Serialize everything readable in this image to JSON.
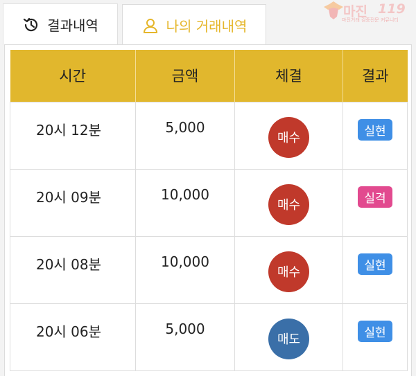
{
  "tabs": [
    {
      "label": "결과내역",
      "icon": "history-icon",
      "active": false
    },
    {
      "label": "나의 거래내역",
      "icon": "user-icon",
      "active": true
    }
  ],
  "logo": {
    "main": "마진",
    "num": "119",
    "sub": "마진거래 검증전문 커뮤니티"
  },
  "table": {
    "headers": [
      "시간",
      "금액",
      "체결",
      "결과"
    ],
    "rows": [
      {
        "time": "20시 12분",
        "amount": "5,000",
        "trade": "매수",
        "result": "실현"
      },
      {
        "time": "20시 09분",
        "amount": "10,000",
        "trade": "매수",
        "result": "실격"
      },
      {
        "time": "20시 08분",
        "amount": "10,000",
        "trade": "매수",
        "result": "실현"
      },
      {
        "time": "20시 06분",
        "amount": "5,000",
        "trade": "매도",
        "result": "실현"
      }
    ]
  },
  "colors": {
    "header_bg": "#e1b72d",
    "active_tab_text": "#e5b62a",
    "buy": "#c0392b",
    "sell": "#3a6fa8",
    "result_success": "#3f8fe6",
    "result_fail": "#e24a8f"
  }
}
